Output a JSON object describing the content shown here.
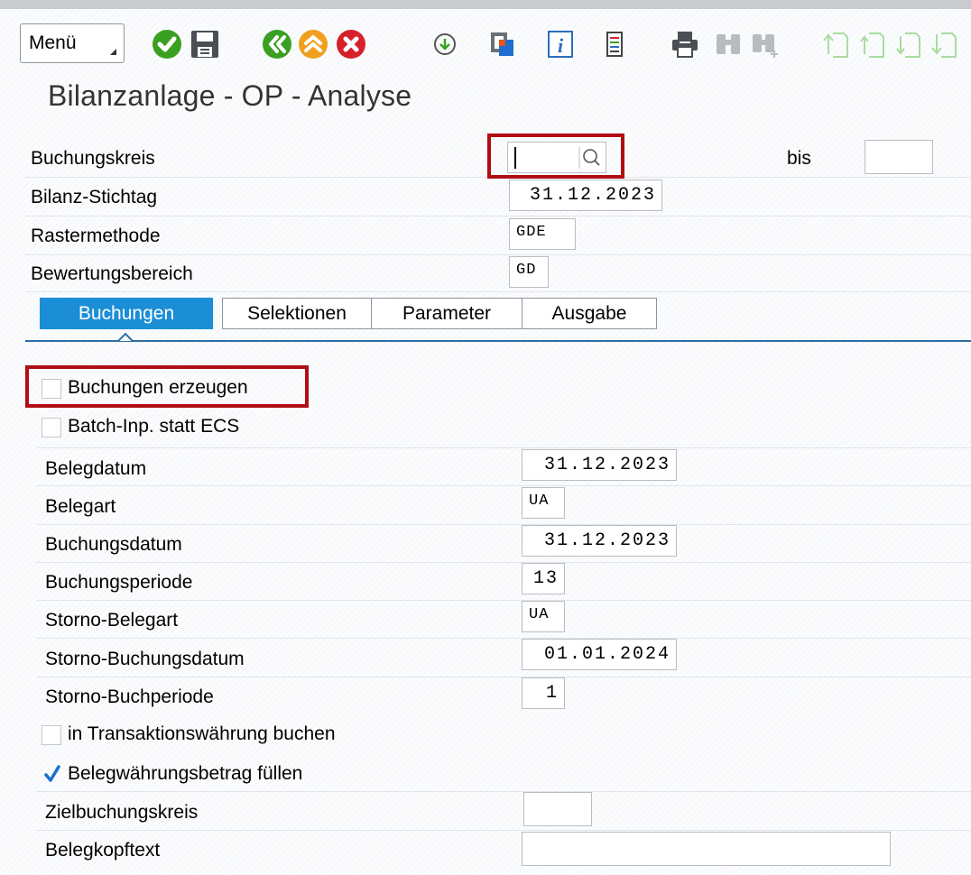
{
  "toolbar": {
    "menu_label": "Menü",
    "icons": [
      "enter-check-icon",
      "save-icon",
      "back-icon",
      "exit-icon",
      "cancel-icon",
      "execute-icon",
      "variant-icon",
      "info-icon",
      "list-icon",
      "print-icon",
      "find-icon",
      "find-next-icon",
      "first-page-icon",
      "previous-page-icon",
      "next-page-icon",
      "last-page-icon"
    ],
    "colors": {
      "green": "#3aa021",
      "orange": "#f0a01e",
      "red": "#d5202b",
      "selection_red": "#b10d14",
      "tab_active": "#1b8ed6"
    }
  },
  "title": "Bilanzanlage - OP - Analyse",
  "header_fields": {
    "buchungskreis": {
      "label": "Buchungskreis",
      "value": "",
      "bis_label": "bis",
      "bis_value": ""
    },
    "stichtag": {
      "label": "Bilanz-Stichtag",
      "value": "31.12.2023"
    },
    "rastermethode": {
      "label": "Rastermethode",
      "value": "GDE"
    },
    "bewertungsbereich": {
      "label": "Bewertungsbereich",
      "value": "GD"
    }
  },
  "tabs": [
    {
      "label": "Buchungen",
      "active": true
    },
    {
      "label": "Selektionen",
      "active": false
    },
    {
      "label": "Parameter",
      "active": false
    },
    {
      "label": "Ausgabe",
      "active": false
    }
  ],
  "buchungen": {
    "erzeugen": {
      "label": "Buchungen erzeugen",
      "checked": false
    },
    "batch": {
      "label": "Batch-Inp. statt ECS",
      "checked": false
    },
    "belegdatum": {
      "label": "Belegdatum",
      "value": "31.12.2023"
    },
    "belegart": {
      "label": "Belegart",
      "value": "UA"
    },
    "buchungsdatum": {
      "label": "Buchungsdatum",
      "value": "31.12.2023"
    },
    "buchungsperiode": {
      "label": "Buchungsperiode",
      "value": "13"
    },
    "storno_belegart": {
      "label": "Storno-Belegart",
      "value": "UA"
    },
    "storno_buchungsdatum": {
      "label": "Storno-Buchungsdatum",
      "value": "01.01.2024"
    },
    "storno_buchperiode": {
      "label": "Storno-Buchperiode",
      "value": "1"
    },
    "transaktionswaehrung": {
      "label": "in Transaktionswährung buchen",
      "checked": false
    },
    "belegwaehrung": {
      "label": "Belegwährungsbetrag füllen",
      "checked": true
    },
    "zielbuchungskreis": {
      "label": "Zielbuchungskreis",
      "value": ""
    },
    "belegkopftext": {
      "label": "Belegkopftext",
      "value": ""
    }
  }
}
